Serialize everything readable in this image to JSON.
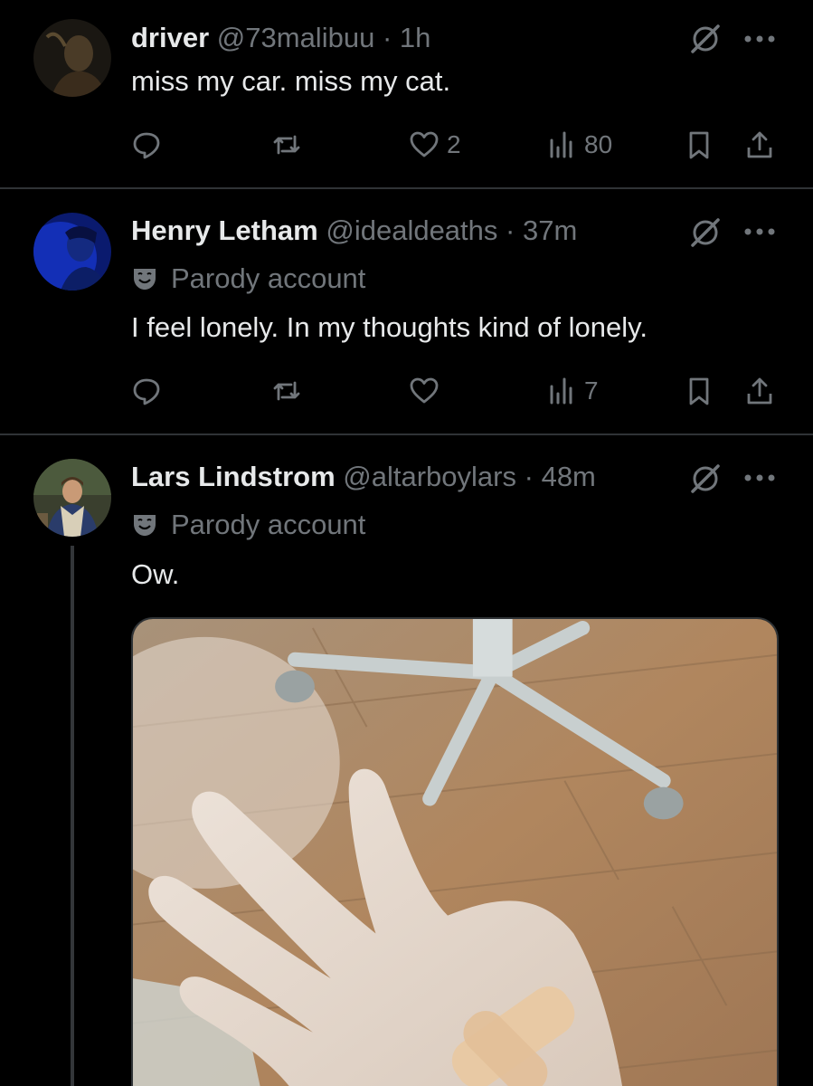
{
  "tweets": [
    {
      "name": "driver",
      "handle": "@73malibuu",
      "separator": "·",
      "time": "1h",
      "parody_label": "",
      "text": "miss my car. miss my cat.",
      "replies": "",
      "reposts": "",
      "likes": "2",
      "views": "80"
    },
    {
      "name": "Henry Letham",
      "handle": "@idealdeaths",
      "separator": "·",
      "time": "37m",
      "parody_label": "Parody account",
      "text": "I feel lonely. In my thoughts kind of lonely.",
      "replies": "",
      "reposts": "",
      "likes": "",
      "views": "7"
    },
    {
      "name": "Lars Lindstrom",
      "handle": "@altarboylars",
      "separator": "·",
      "time": "48m",
      "parody_label": "Parody account",
      "text": "Ow."
    }
  ],
  "icons": {
    "reply": "reply-icon",
    "repost": "repost-icon",
    "like": "heart-icon",
    "views": "views-icon",
    "bookmark": "bookmark-icon",
    "share": "share-icon",
    "grok": "grok-icon",
    "more": "more-icon",
    "parody": "parody-mask-icon"
  },
  "colors": {
    "background": "#000000",
    "primary_text": "#e7e9ea",
    "secondary_text": "#71767b",
    "divider": "#2f3336"
  }
}
